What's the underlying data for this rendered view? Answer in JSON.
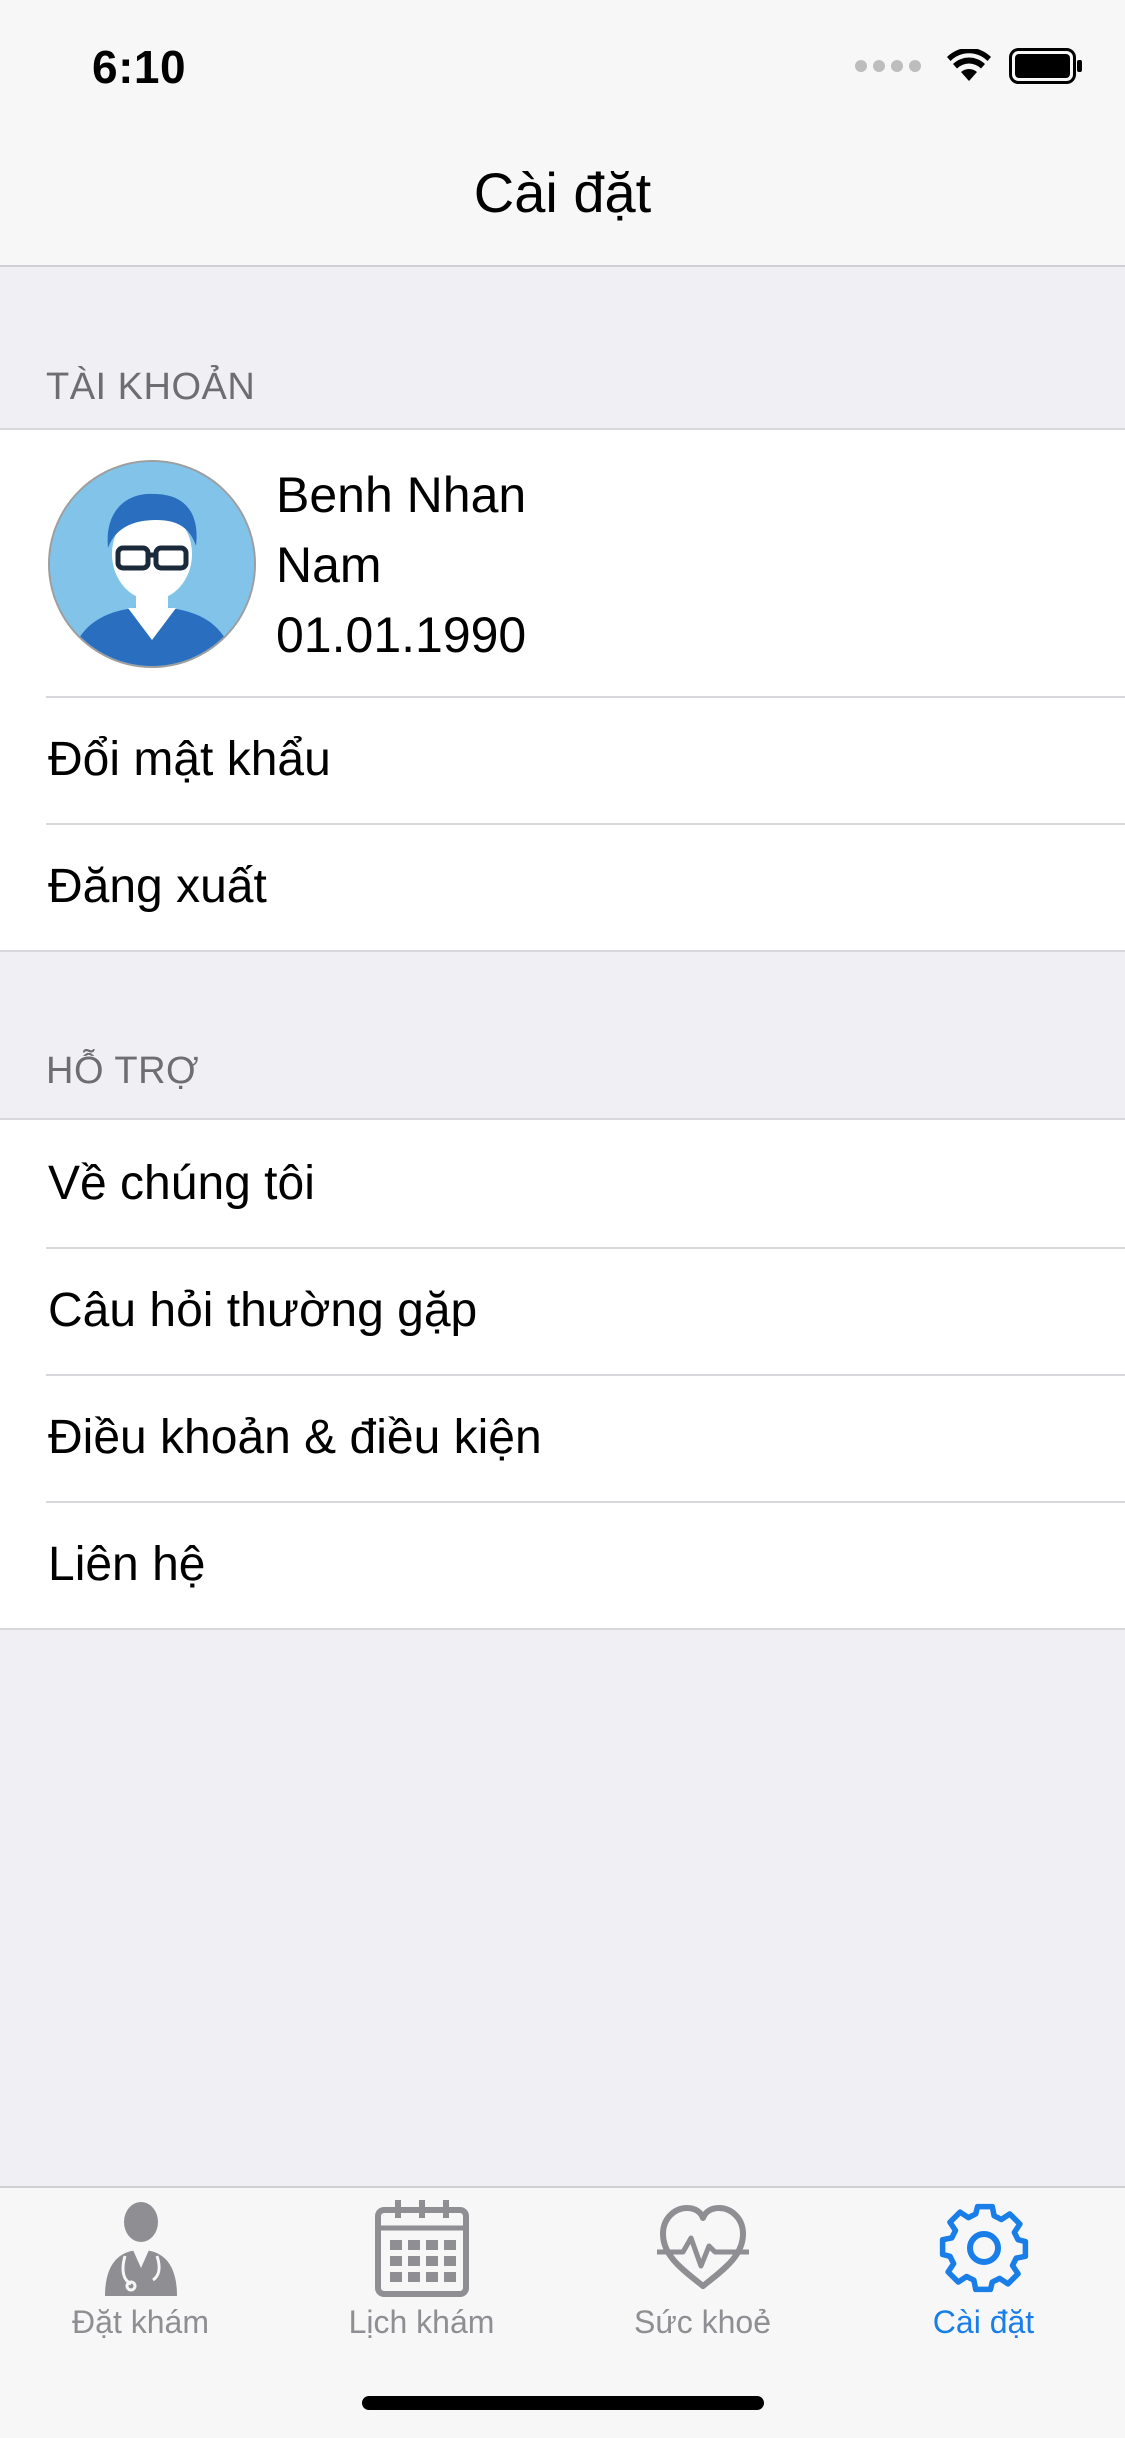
{
  "status_bar": {
    "time": "6:10"
  },
  "nav": {
    "title": "Cài đặt"
  },
  "account": {
    "header": "TÀI KHOẢN",
    "profile": {
      "name": "Benh Nhan",
      "gender": "Nam",
      "dob": "01.01.1990"
    },
    "items": [
      {
        "label": "Đổi mật khẩu"
      },
      {
        "label": "Đăng xuất"
      }
    ]
  },
  "support": {
    "header": "HỖ TRỢ",
    "items": [
      {
        "label": "Về chúng tôi"
      },
      {
        "label": "Câu hỏi thường gặp"
      },
      {
        "label": "Điều khoản & điều kiện"
      },
      {
        "label": "Liên hệ"
      }
    ]
  },
  "tabbar": {
    "active_color": "#1A7EE8",
    "inactive_color": "#8E8E93",
    "tabs": [
      {
        "label": "Đặt khám",
        "icon": "doctor-icon"
      },
      {
        "label": "Lịch khám",
        "icon": "calendar-icon"
      },
      {
        "label": "Sức khoẻ",
        "icon": "heart-pulse-icon"
      },
      {
        "label": "Cài đặt",
        "icon": "gear-icon"
      }
    ],
    "active_tab": "Cài đặt"
  }
}
